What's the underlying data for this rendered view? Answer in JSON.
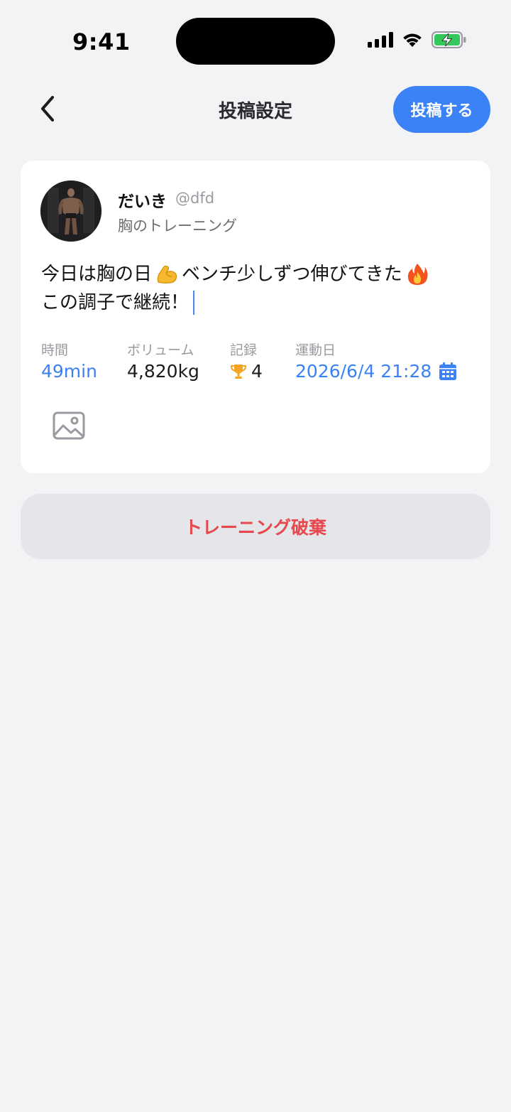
{
  "status_bar": {
    "time": "9:41"
  },
  "nav": {
    "title": "投稿設定",
    "post_button_label": "投稿する",
    "accent_color": "#3b82f6"
  },
  "post": {
    "user_name": "だいき",
    "user_handle": "@dfd",
    "workout_name": "胸のトレーニング",
    "text_line1_part1": "今日は胸の日",
    "text_line1_emoji1": "flexed-biceps-emoji",
    "text_line1_part2": "ベンチ少しずつ伸びてきた",
    "text_line1_emoji2": "fire-emoji",
    "text_line2": "この調子で継続！"
  },
  "stats": {
    "time_label": "時間",
    "time_value": "49min",
    "volume_label": "ボリューム",
    "volume_value": "4,820kg",
    "record_label": "記録",
    "record_value": "4",
    "date_label": "運動日",
    "date_value": "2026/6/4 21:28"
  },
  "actions": {
    "discard_label": "トレーニング破棄",
    "discard_color": "#e5484d"
  }
}
